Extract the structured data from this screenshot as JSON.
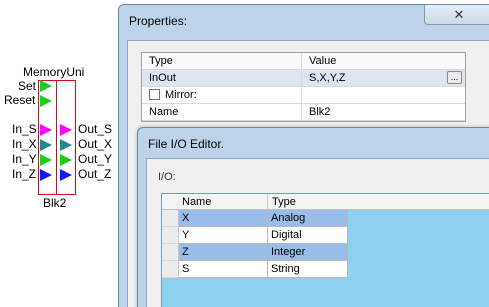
{
  "block": {
    "title": "MemoryUni",
    "name": "Blk2",
    "inputs": [
      "Set",
      "Reset",
      "In_S",
      "In_X",
      "In_Y",
      "In_Z"
    ],
    "outputs": [
      "Out_S",
      "Out_X",
      "Out_Y",
      "Out_Z"
    ],
    "colors": {
      "outline": "#d0101a",
      "set": "#1ccf1c",
      "s": "#ff00ff",
      "x": "#228a88",
      "y": "#1ccf1c",
      "z": "#1616ff"
    }
  },
  "properties": {
    "title": "Properties:",
    "close_icon": "✕",
    "headers": {
      "type": "Type",
      "value": "Value"
    },
    "rows": [
      {
        "type": "InOut",
        "value": "S,X,Y,Z",
        "button": "..."
      },
      {
        "type": "Mirror:",
        "value": ""
      },
      {
        "type": "Name",
        "value": "Blk2"
      }
    ]
  },
  "fio_editor": {
    "title": "File I/O Editor.",
    "io_label": "I/O:",
    "headers": {
      "name": "Name",
      "type": "Type"
    },
    "rows": [
      {
        "name": "X",
        "type": "Analog"
      },
      {
        "name": "Y",
        "type": "Digital"
      },
      {
        "name": "Z",
        "type": "Integer"
      },
      {
        "name": "S",
        "type": "String"
      }
    ]
  }
}
